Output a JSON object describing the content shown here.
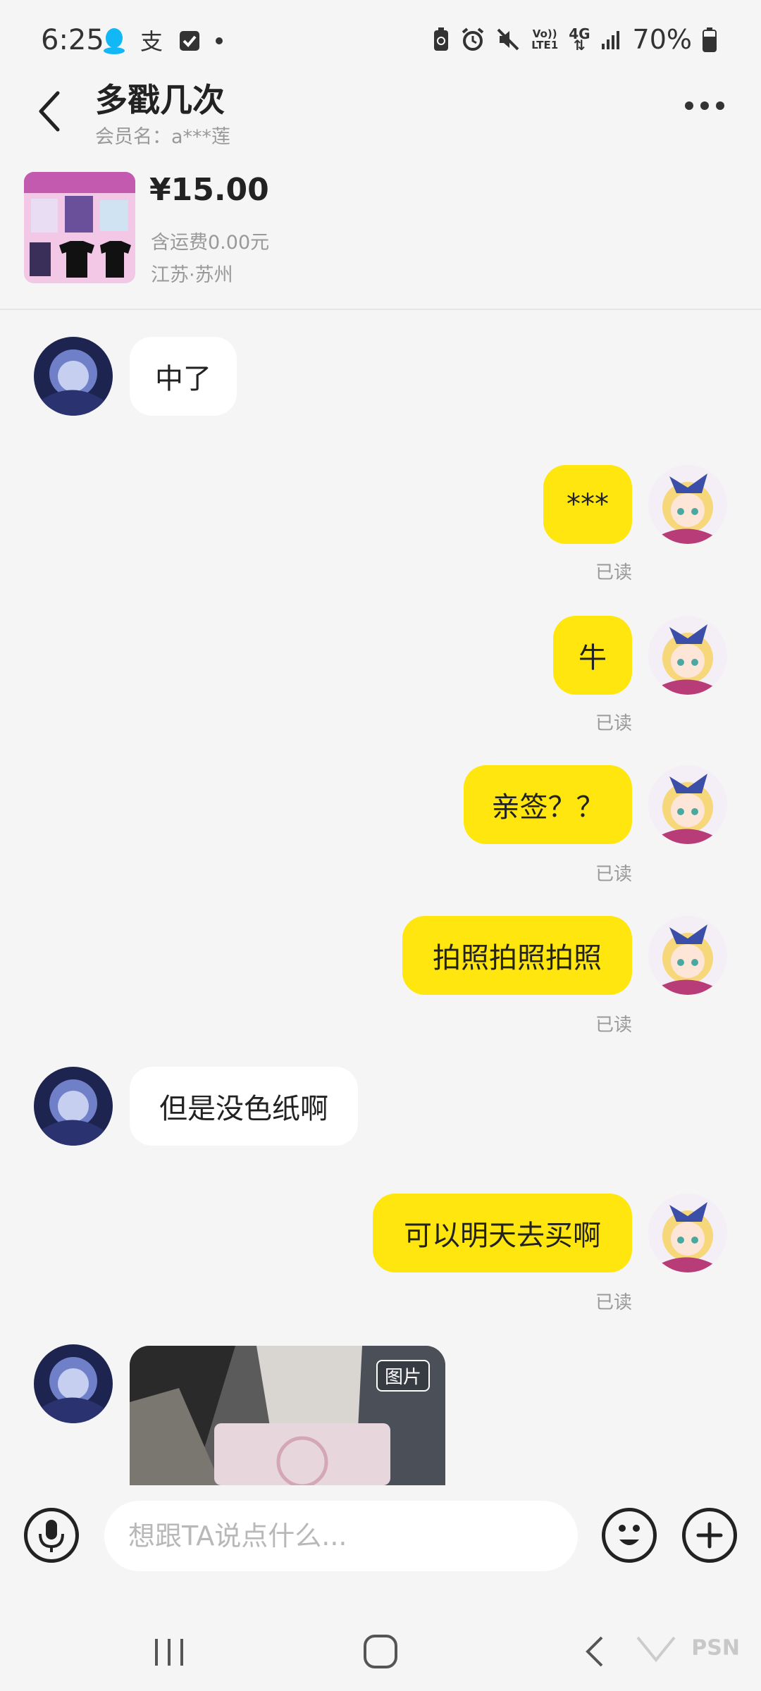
{
  "status_bar": {
    "time": "6:25",
    "left_icons": [
      "qq-icon",
      "alipay-icon",
      "checkbox-icon",
      "dot-icon"
    ],
    "right_icons": [
      "battery-saver-icon",
      "alarm-icon",
      "mute-icon",
      "volte-icon",
      "4g-icon",
      "signal-icon"
    ],
    "volte_label": "Vo)) LTE1",
    "network_label": "4G",
    "battery": "70%"
  },
  "header": {
    "title": "多戳几次",
    "subtitle": "会员名：a***莲"
  },
  "product": {
    "price": "¥15.00",
    "shipping": "含运费0.00元",
    "location": "江苏·苏州"
  },
  "messages": [
    {
      "side": "them",
      "text": "中了"
    },
    {
      "side": "me",
      "text": "***",
      "status": "已读"
    },
    {
      "side": "me",
      "text": "牛",
      "status": "已读"
    },
    {
      "side": "me",
      "text": "亲签？？",
      "status": "已读"
    },
    {
      "side": "me",
      "text": "拍照拍照拍照",
      "status": "已读"
    },
    {
      "side": "them",
      "text": "但是没色纸啊"
    },
    {
      "side": "me",
      "text": "可以明天去买啊",
      "status": "已读"
    },
    {
      "side": "them",
      "type": "image",
      "badge": "图片"
    }
  ],
  "input": {
    "placeholder": "想跟TA说点什么..."
  },
  "watermark": "PSN",
  "colors": {
    "my_bubble": "#ffe60f",
    "their_bubble": "#ffffff",
    "background": "#f5f5f5"
  }
}
